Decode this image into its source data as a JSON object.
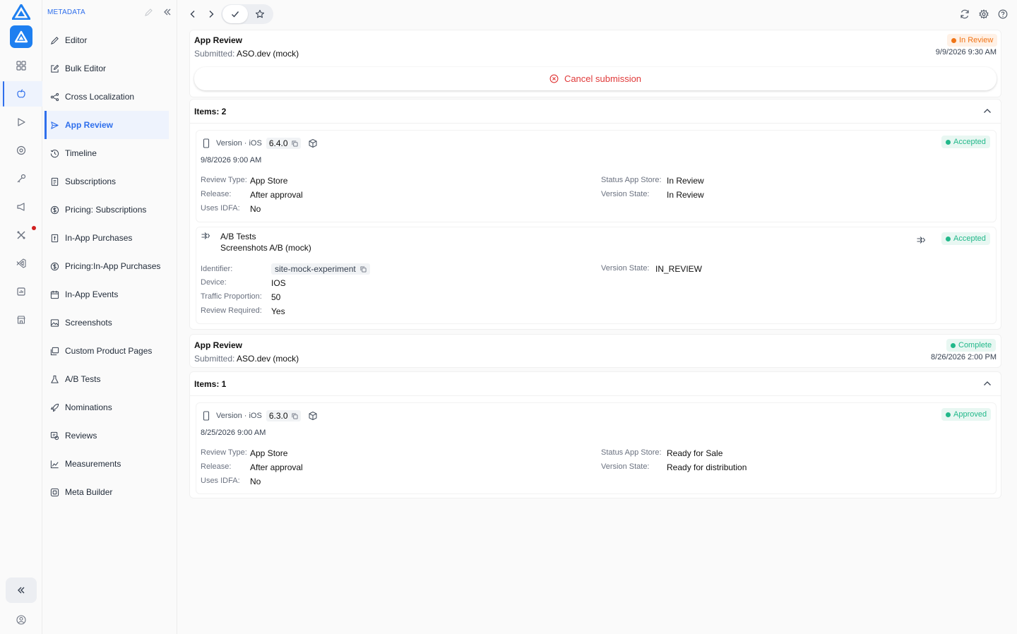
{
  "sidebar": {
    "title": "METADATA",
    "items": [
      {
        "label": "Editor",
        "icon": "pencil-icon"
      },
      {
        "label": "Bulk Editor",
        "icon": "edit-square-icon"
      },
      {
        "label": "Cross Localization",
        "icon": "share-icon"
      },
      {
        "label": "App Review",
        "icon": "send-icon"
      },
      {
        "label": "Timeline",
        "icon": "history-icon"
      },
      {
        "label": "Subscriptions",
        "icon": "receipt-icon"
      },
      {
        "label": "Pricing: Subscriptions",
        "icon": "dollar-circle-icon"
      },
      {
        "label": "In-App Purchases",
        "icon": "receipt-icon"
      },
      {
        "label": "Pricing:In-App Purchases",
        "icon": "dollar-circle-icon"
      },
      {
        "label": "In-App Events",
        "icon": "calendar-icon"
      },
      {
        "label": "Screenshots",
        "icon": "image-icon"
      },
      {
        "label": "Custom Product Pages",
        "icon": "images-icon"
      },
      {
        "label": "A/B Tests",
        "icon": "flask-icon"
      },
      {
        "label": "Nominations",
        "icon": "rocket-icon"
      },
      {
        "label": "Reviews",
        "icon": "review-icon"
      },
      {
        "label": "Measurements",
        "icon": "chart-icon"
      },
      {
        "label": "Meta Builder",
        "icon": "builder-icon"
      }
    ]
  },
  "reviews": [
    {
      "title": "App Review",
      "submitted_label": "Submitted:",
      "submitted_by": "ASO.dev (mock)",
      "status": "In Review",
      "date": "9/9/2026 9:30 AM",
      "cancel_label": "Cancel submission",
      "items_label": "Items: 2",
      "version": {
        "label": "Version · iOS",
        "number": "6.4.0",
        "date": "9/8/2026 9:00 AM",
        "status": "Accepted",
        "review_type_label": "Review Type:",
        "review_type": "App Store",
        "release_label": "Release:",
        "release": "After approval",
        "idfa_label": "Uses IDFA:",
        "idfa": "No",
        "store_status_label": "Status App Store:",
        "store_status": "In Review",
        "version_state_label": "Version State:",
        "version_state": "In Review"
      },
      "ab_test": {
        "title": "A/B Tests",
        "name": "Screenshots A/B (mock)",
        "status": "Accepted",
        "identifier_label": "Identifier:",
        "identifier": "site-mock-experiment",
        "device_label": "Device:",
        "device": "IOS",
        "traffic_label": "Traffic Proportion:",
        "traffic": "50",
        "review_required_label": "Review Required:",
        "review_required": "Yes",
        "version_state_label": "Version State:",
        "version_state": "IN_REVIEW"
      }
    },
    {
      "title": "App Review",
      "submitted_label": "Submitted:",
      "submitted_by": "ASO.dev (mock)",
      "status": "Complete",
      "date": "8/26/2026 2:00 PM",
      "items_label": "Items: 1",
      "version": {
        "label": "Version · iOS",
        "number": "6.3.0",
        "date": "8/25/2026 9:00 AM",
        "status": "Approved",
        "review_type_label": "Review Type:",
        "review_type": "App Store",
        "release_label": "Release:",
        "release": "After approval",
        "idfa_label": "Uses IDFA:",
        "idfa": "No",
        "store_status_label": "Status App Store:",
        "store_status": "Ready for Sale",
        "version_state_label": "Version State:",
        "version_state": "Ready for distribution"
      }
    }
  ],
  "colors": {
    "accent": "#2f6fec",
    "danger": "#e03a3a",
    "in_review": "#f07416",
    "success": "#22b88a"
  }
}
